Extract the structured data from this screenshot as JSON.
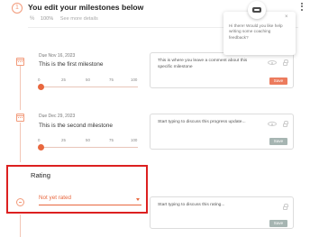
{
  "header": {
    "step_number": "1",
    "title": "You edit your milestones below",
    "progress_percent": "100%",
    "more_details_label": "See more details"
  },
  "milestones": [
    {
      "date": "Due Nov 16, 2023",
      "name": "This is the first milestone",
      "progress": 0,
      "ticks": [
        "0",
        "25",
        "50",
        "75",
        "100"
      ],
      "comment": "This is where you leave a comment about this specific milestone",
      "save_label": "Save",
      "save_enabled": true
    },
    {
      "date": "Due Dec 29, 2023",
      "name": "This is the second milestone",
      "progress": 0,
      "ticks": [
        "0",
        "25",
        "50",
        "75",
        "100"
      ],
      "comment_placeholder": "Start typing to discuss this progress update...",
      "save_label": "Save",
      "save_enabled": false
    }
  ],
  "rating": {
    "heading": "Rating",
    "selected_value": "Not yet rated",
    "comment_placeholder": "Start typing to discuss this rating...",
    "save_label": "Save",
    "save_enabled": false
  },
  "coach_tooltip": {
    "text": "Hi there! Would you like help writing some coaching feedback?",
    "close_symbol": "×"
  },
  "colors": {
    "accent": "#e8673e",
    "highlight_frame": "#dc2020",
    "save_disabled": "#a6b5b2"
  }
}
